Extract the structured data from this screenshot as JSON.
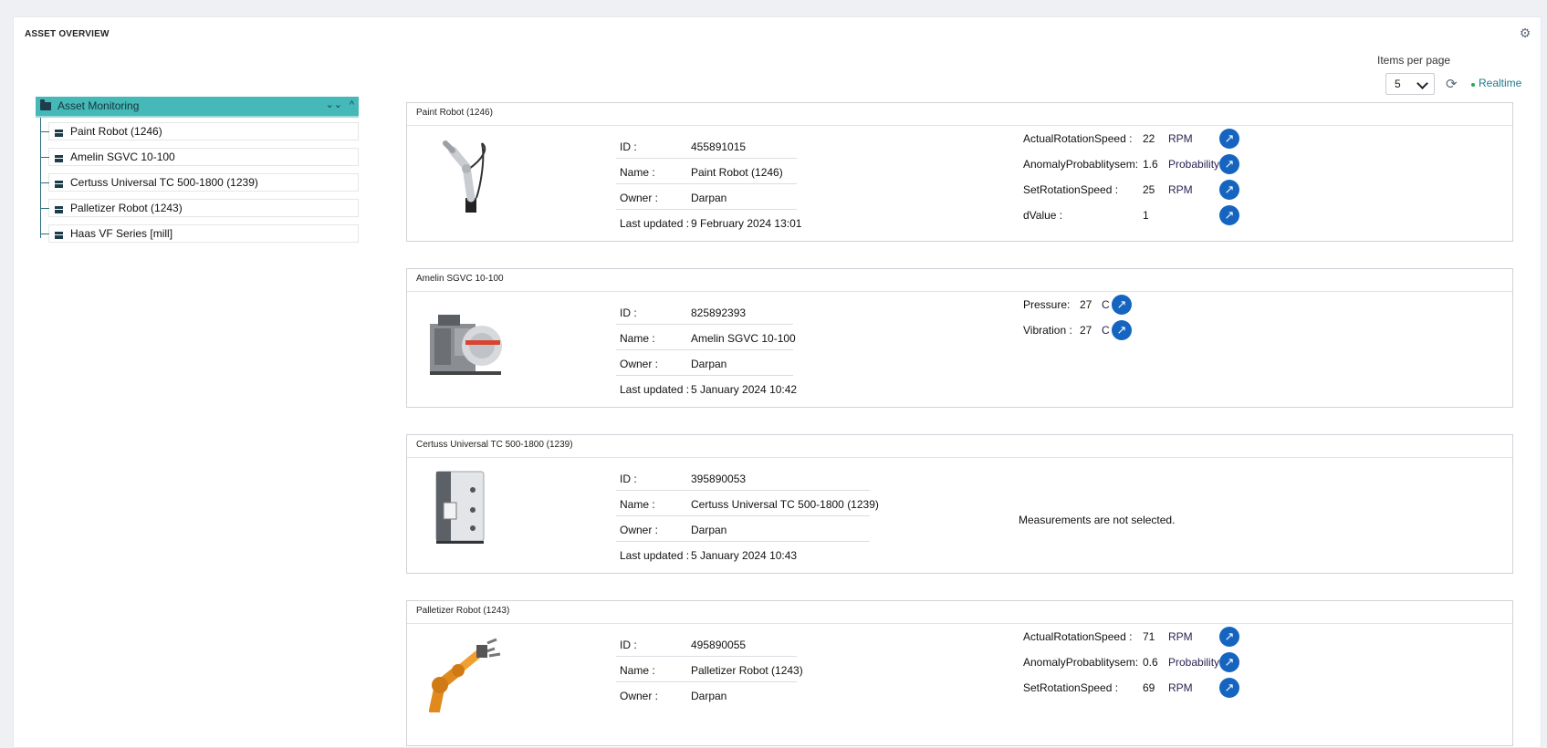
{
  "panel": {
    "title": "ASSET OVERVIEW"
  },
  "icons": {
    "settings": "gear-icon",
    "refresh": "refresh-icon",
    "trend": "trend-arrow-icon",
    "folder": "folder-icon",
    "asset": "asset-icon"
  },
  "colors": {
    "tree_header": "#45b8b8",
    "trend_button": "#1565c0",
    "realtime": "#1f7a8c",
    "realtime_dot": "#2ea44f"
  },
  "toolbar": {
    "items_per_page_label": "Items per page",
    "items_per_page_value": "5",
    "realtime_label": "Realtime"
  },
  "tree": {
    "root": "Asset Monitoring",
    "items": [
      {
        "label": "Paint Robot (1246)"
      },
      {
        "label": "Amelin SGVC 10-100"
      },
      {
        "label": "Certuss Universal TC 500-1800 (1239)"
      },
      {
        "label": "Palletizer Robot (1243)"
      },
      {
        "label": "Haas VF Series [mill]"
      }
    ]
  },
  "info_labels": {
    "id": "ID :",
    "name": "Name :",
    "owner": "Owner :",
    "updated": "Last updated :"
  },
  "cards": [
    {
      "title": "Paint Robot (1246)",
      "id": "455891015",
      "name": "Paint Robot (1246)",
      "owner": "Darpan",
      "updated": "9 February 2024 13:01",
      "measurements": [
        {
          "label": "ActualRotationSpeed :",
          "value": "22",
          "unit": "RPM"
        },
        {
          "label": "AnomalyProbablitysem:",
          "value": "1.6",
          "unit": "Probability"
        },
        {
          "label": "SetRotationSpeed :",
          "value": "25",
          "unit": "RPM"
        },
        {
          "label": "dValue :",
          "value": "1",
          "unit": ""
        }
      ]
    },
    {
      "title": "Amelin SGVC 10-100",
      "id": "825892393",
      "name": "Amelin SGVC 10-100",
      "owner": "Darpan",
      "updated": "5 January 2024 10:42",
      "measurements": [
        {
          "label": "Pressure:",
          "value": "27",
          "unit": "C"
        },
        {
          "label": "Vibration :",
          "value": "27",
          "unit": "C"
        }
      ]
    },
    {
      "title": "Certuss Universal TC 500-1800 (1239)",
      "id": "395890053",
      "name": "Certuss Universal TC 500-1800 (1239)",
      "owner": "Darpan",
      "updated": "5 January 2024 10:43",
      "no_measurements": "Measurements are not selected."
    },
    {
      "title": "Palletizer Robot (1243)",
      "id": "495890055",
      "name": "Palletizer Robot (1243)",
      "owner": "Darpan",
      "measurements": [
        {
          "label": "ActualRotationSpeed :",
          "value": "71",
          "unit": "RPM"
        },
        {
          "label": "AnomalyProbablitysem:",
          "value": "0.6",
          "unit": "Probability"
        },
        {
          "label": "SetRotationSpeed :",
          "value": "69",
          "unit": "RPM"
        }
      ]
    }
  ]
}
